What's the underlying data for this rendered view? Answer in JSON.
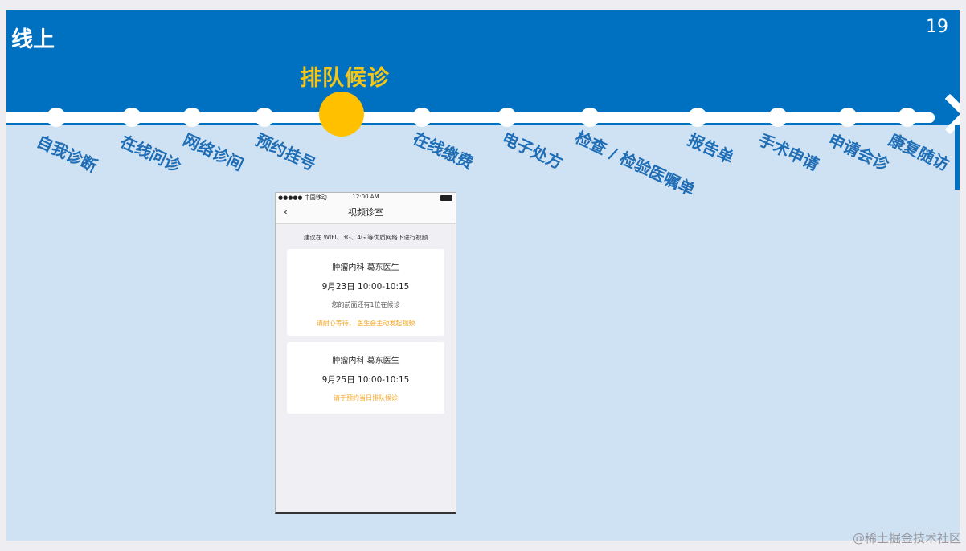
{
  "slide": {
    "title": "线上",
    "page_number": "19",
    "current_step": "排队候诊",
    "steps": [
      "自我诊断",
      "在线问诊",
      "网络诊间",
      "预约挂号",
      "在线缴费",
      "电子处方",
      "检查 / 检验医嘱单",
      "报告单",
      "手术申请",
      "申请会诊",
      "康复随访"
    ]
  },
  "phone": {
    "carrier": "●●●●● 中国移动",
    "time": "12:00 AM",
    "nav_title": "视频诊室",
    "back_icon": "‹",
    "hint": "建议在 WIFI、3G、4G 等优质网络下进行视频",
    "cards": [
      {
        "doctor": "肿瘤内科 葛东医生",
        "datetime": "9月23日 10:00-10:15",
        "queue": "您的前面还有1位在候诊",
        "notice": "请耐心等待， 医生会主动发起视频"
      },
      {
        "doctor": "肿瘤内科 葛东医生",
        "datetime": "9月25日 10:00-10:15",
        "notice": "请于预约当日排队候诊"
      }
    ]
  },
  "watermark": "@稀土掘金技术社区",
  "colors": {
    "header": "#0071c1",
    "background": "#cfe2f4",
    "accent": "#ffc000",
    "label": "#1f6db5",
    "notice": "#f5a623"
  }
}
